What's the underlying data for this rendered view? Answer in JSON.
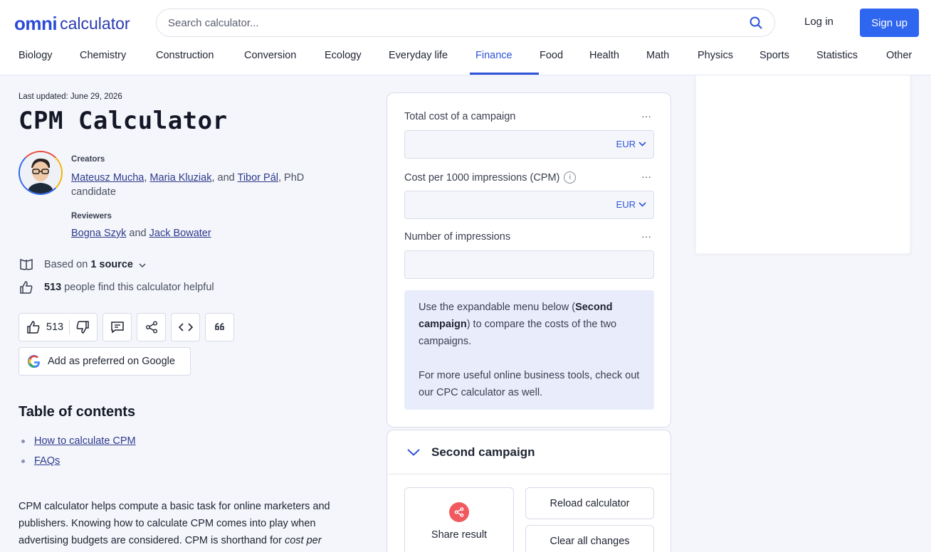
{
  "header": {
    "logo_omni": "omni",
    "logo_calculator": "calculator",
    "search_placeholder": "Search calculator...",
    "login": "Log in",
    "signup": "Sign up"
  },
  "nav": [
    {
      "label": "Biology"
    },
    {
      "label": "Chemistry"
    },
    {
      "label": "Construction"
    },
    {
      "label": "Conversion"
    },
    {
      "label": "Ecology"
    },
    {
      "label": "Everyday life"
    },
    {
      "label": "Finance",
      "active": true
    },
    {
      "label": "Food"
    },
    {
      "label": "Health"
    },
    {
      "label": "Math"
    },
    {
      "label": "Physics"
    },
    {
      "label": "Sports"
    },
    {
      "label": "Statistics"
    },
    {
      "label": "Other"
    }
  ],
  "article": {
    "last_updated_label": "Last updated:",
    "last_updated_date": "June 29, 2026",
    "title": "CPM Calculator",
    "creators_label": "Creators",
    "creator_1": "Mateusz Mucha",
    "creator_2": "Maria Kluziak",
    "and": "and",
    "creator_3": "Tibor Pál",
    "creator_3_suffix": ", PhD candidate",
    "reviewers_label": "Reviewers",
    "reviewer_1": "Bogna Szyk",
    "reviewer_2": "Jack Bowater",
    "based_on": "Based on",
    "sources": "1 source",
    "helpful_count": "513",
    "helpful_text": "people find this calculator helpful",
    "like_count": "513",
    "google_btn": "Add as preferred on Google",
    "toc_title": "Table of contents",
    "toc_items": [
      "How to calculate CPM",
      "FAQs"
    ],
    "intro_1": "CPM calculator helps compute a basic task for online marketers and publishers. Knowing how to calculate CPM comes into play when advertising budgets are considered. CPM is shorthand for ",
    "intro_italic": "cost per"
  },
  "calculator": {
    "field_1_label": "Total cost of a campaign",
    "field_1_unit": "EUR",
    "field_2_label": "Cost per 1000 impressions (CPM)",
    "field_2_unit": "EUR",
    "field_3_label": "Number of impressions",
    "dots": "···",
    "info": "i",
    "note_1_pre": "Use the expandable menu below (",
    "note_1_bold": "Second campaign",
    "note_1_post": ") to compare the costs of the two campaigns.",
    "note_2": "For more useful online business tools, check out our CPC calculator as well."
  },
  "second_campaign": {
    "title": "Second campaign",
    "share": "Share result",
    "reload": "Reload calculator",
    "clear": "Clear all changes"
  },
  "colors": {
    "brand": "#2f66f0",
    "link": "#2e3a8c",
    "note_bg": "#e9ecfb",
    "share": "#f05a5f"
  }
}
